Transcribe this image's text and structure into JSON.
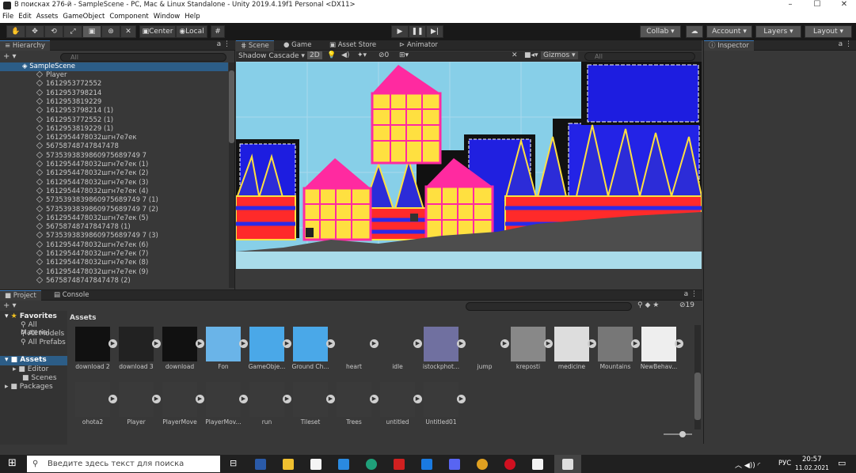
{
  "window": {
    "title": "В поисках 276-й - SampleScene - PC, Mac & Linux Standalone - Unity 2019.4.19f1 Personal <DX11>"
  },
  "menu": [
    "File",
    "Edit",
    "Assets",
    "GameObject",
    "Component",
    "Window",
    "Help"
  ],
  "toolbar": {
    "center": "Center",
    "local": "Local",
    "collab": "Collab ▾",
    "account": "Account",
    "layers": "Layers",
    "layout": "Layout"
  },
  "hierarchy": {
    "title": "Hierarchy",
    "search_placeholder": "All",
    "scene": "SampleScene",
    "items": [
      "Player",
      "1612953772552",
      "1612953798214",
      "1612953819229",
      "1612953798214 (1)",
      "1612953772552 (1)",
      "1612953819229 (1)",
      "1612954478032шгн7е7ек",
      "56758748747847478",
      "5735393839860975689749 7",
      "1612954478032шгн7е7ек (1)",
      "1612954478032шгн7е7ек (2)",
      "1612954478032шгн7е7ек (3)",
      "1612954478032шгн7е7ек (4)",
      "5735393839860975689749 7 (1)",
      "5735393839860975689749 7 (2)",
      "1612954478032шгн7е7ек (5)",
      "56758748747847478 (1)",
      "5735393839860975689749 7 (3)",
      "1612954478032шгн7е7ек (6)",
      "1612954478032шгн7е7ек (7)",
      "1612954478032шгн7е7ек (8)",
      "1612954478032шгн7е7ек (9)",
      "56758748747847478 (2)"
    ]
  },
  "scene": {
    "tabs": [
      "Scene",
      "Game",
      "Asset Store",
      "Animator"
    ],
    "shading": "Shadow Cascade ▾",
    "mode2d": "2D",
    "gizmos": "Gizmos",
    "search": "All",
    "hidden": "0"
  },
  "inspector": {
    "title": "Inspector"
  },
  "project": {
    "tabs": [
      "Project",
      "Console"
    ],
    "count": "19",
    "breadcrumb": "Assets",
    "favorites": {
      "label": "Favorites",
      "items": [
        "All Material",
        "All Models",
        "All Prefabs"
      ]
    },
    "tree": {
      "assets": "Assets",
      "children": [
        "Editor",
        "Scenes"
      ],
      "packages": "Packages"
    },
    "assets_row1": [
      "download 2",
      "download 3",
      "download",
      "Fon",
      "GameObje...",
      "Ground Ch...",
      "heart",
      "idle",
      "istockphot...",
      "jump",
      "kreposti",
      "medicine",
      "Mountains",
      "NewBehav..."
    ],
    "assets_row2": [
      "ohota2",
      "Player",
      "PlayerMove",
      "PlayerMov...",
      "run",
      "Tileset",
      "Trees",
      "untitled",
      "Untitled01"
    ]
  },
  "taskbar": {
    "search": "Введите здесь текст для поиска",
    "lang": "РУС",
    "time": "20:57",
    "date": "11.02.2021"
  }
}
